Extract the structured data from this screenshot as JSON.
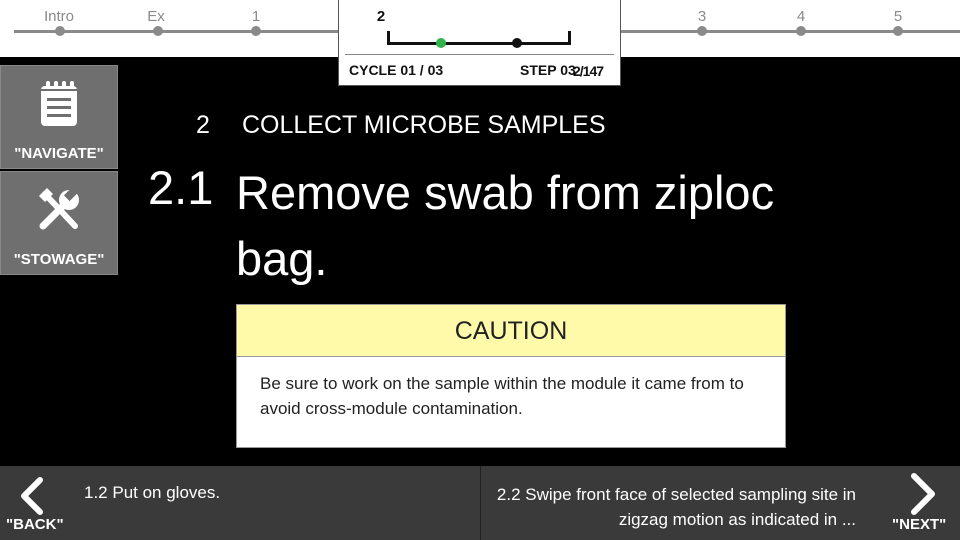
{
  "progress": {
    "stages": [
      {
        "label": "Intro"
      },
      {
        "label": "Ex"
      },
      {
        "label": "1"
      },
      {
        "label": "3"
      },
      {
        "label": "4"
      },
      {
        "label": "5"
      }
    ],
    "current_stage": "2",
    "cycle": "CYCLE 01 / 03",
    "step": "STEP 03",
    "step_overlay": "2/147",
    "colors": {
      "done": "#2fb54a",
      "current": "#111111",
      "track": "#8a8a8a"
    }
  },
  "sidebar": {
    "navigate_label": "\"NAVIGATE\"",
    "navigate_icon": "notepad-icon",
    "stowage_label": "\"STOWAGE\"",
    "stowage_icon": "tools-icon"
  },
  "content": {
    "section_number": "2",
    "section_title": "COLLECT MICROBE SAMPLES",
    "step_number": "2.1",
    "step_title": "Remove swab from ziploc bag.",
    "caution": {
      "heading": "CAUTION",
      "text": "Be sure to work on the sample within the module it came from to avoid cross-module contamination.",
      "header_color": "#fffaaa"
    }
  },
  "footer": {
    "back_label": "\"BACK\"",
    "previous_step": "1.2 Put on gloves.",
    "next_label": "\"NEXT\"",
    "next_step": "2.2 Swipe front face of selected sampling site in zigzag motion as indicated in ..."
  }
}
